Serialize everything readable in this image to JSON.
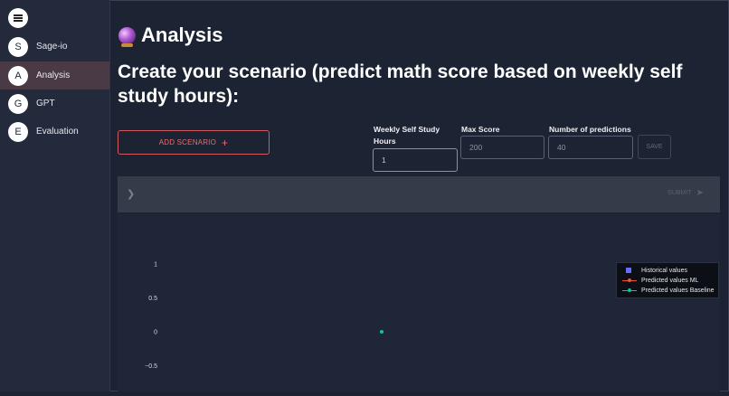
{
  "sidebar": {
    "items": [
      {
        "letter": "S",
        "label": "Sage-io"
      },
      {
        "letter": "A",
        "label": "Analysis"
      },
      {
        "letter": "G",
        "label": "GPT"
      },
      {
        "letter": "E",
        "label": "Evaluation"
      }
    ],
    "active": "Analysis"
  },
  "header": {
    "title": "Analysis",
    "icon": "crystal-ball-icon"
  },
  "headline": "Create your scenario (predict math score based on weekly self study hours):",
  "toolbar": {
    "add_label": "ADD SCENARIO",
    "add_icon": "+",
    "save_label": "SAVE"
  },
  "fields": {
    "hours": {
      "label": "Weekly Self Study Hours",
      "value": "1"
    },
    "max_score": {
      "label": "Max Score",
      "placeholder": "200"
    },
    "predictions": {
      "label": "Number of predictions",
      "placeholder": "40"
    }
  },
  "panel": {
    "submit_label": "SUBMIT"
  },
  "colors": {
    "accent": "#ef6b6f",
    "historical": "#636efa",
    "ml": "#ef553b",
    "baseline": "#00cc96"
  },
  "chart_data": {
    "type": "scatter",
    "y_ticks": [
      "1",
      "0.5",
      "0",
      "−0.5"
    ],
    "series": [
      {
        "name": "Historical values",
        "values": []
      },
      {
        "name": "Predicted values ML",
        "values": []
      },
      {
        "name": "Predicted values Baseline",
        "points": [
          {
            "x": 0,
            "y": 0
          }
        ]
      }
    ]
  }
}
